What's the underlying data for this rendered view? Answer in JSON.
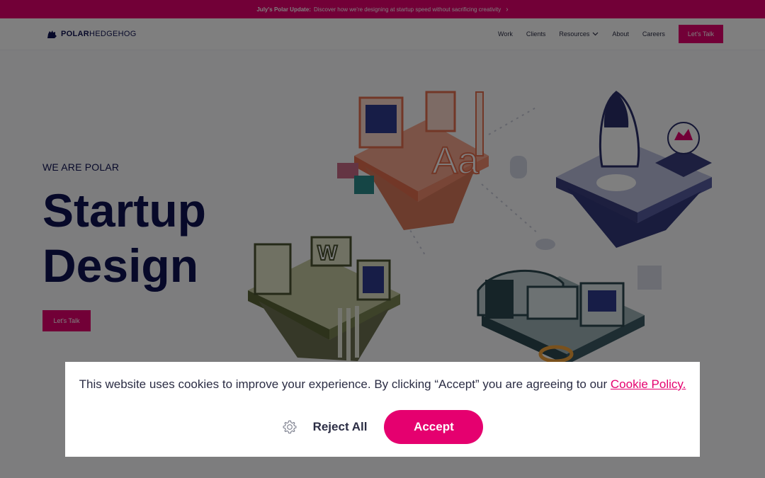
{
  "announcement": {
    "prefix": "July's Polar Update:",
    "text": "Discover how we're designing at startup speed without sacrificing creativity",
    "chevron_icon": "chevron-right-icon"
  },
  "nav": {
    "logo_strong": "POLAR",
    "logo_light": "HEDGEHOG",
    "links": {
      "work": "Work",
      "clients": "Clients",
      "resources": "Resources",
      "about": "About",
      "careers": "Careers"
    },
    "cta": "Let's Talk"
  },
  "hero": {
    "eyebrow": "WE ARE POLAR",
    "headline_line1": "Startup",
    "headline_line2": "Design",
    "cta": "Let's Talk"
  },
  "cookie": {
    "message": "This website uses cookies to improve your experience. By clicking “Accept” you are agreeing to our",
    "policy_link": "Cookie Policy.",
    "reject": "Reject All",
    "accept": "Accept",
    "settings_icon": "gear-icon"
  },
  "colors": {
    "brand": "#e5006f",
    "navy": "#0f1253",
    "text": "#2b2d44"
  }
}
